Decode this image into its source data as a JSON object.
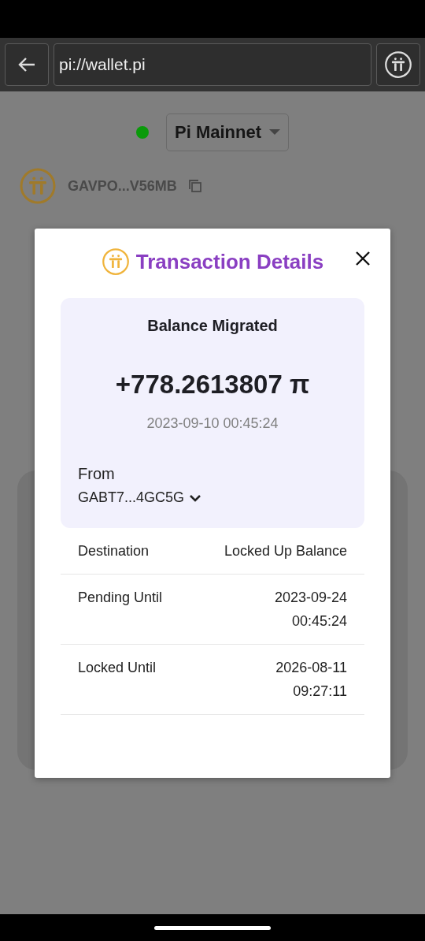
{
  "browser": {
    "url": "pi://wallet.pi"
  },
  "network": {
    "name": "Pi Mainnet",
    "color": "#0a9a0a"
  },
  "account": {
    "address": "GAVPO...V56MB"
  },
  "modal": {
    "title": "Transaction Details",
    "type": "Balance Migrated",
    "amount": "+778.2613807 π",
    "date": "2023-09-10 00:45:24",
    "from_label": "From",
    "from_address": "GABT7...4GC5G",
    "rows": [
      {
        "label": "Destination",
        "value": [
          "Locked Up Balance"
        ]
      },
      {
        "label": "Pending Until",
        "value": [
          "2023-09-24",
          "00:45:24"
        ]
      },
      {
        "label": "Locked Until",
        "value": [
          "2026-08-11",
          "09:27:11"
        ]
      }
    ]
  }
}
